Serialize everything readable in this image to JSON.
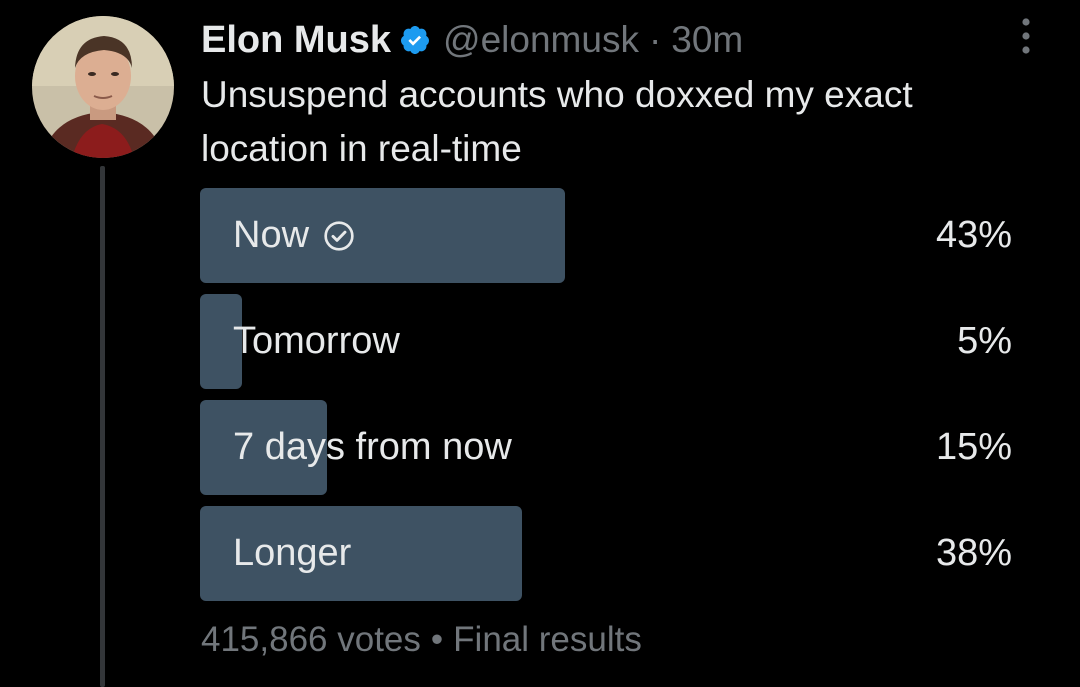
{
  "tweet": {
    "author_name": "Elon Musk",
    "handle": "@elonmusk",
    "separator": "·",
    "time": "30m",
    "text": "Unsuspend accounts who doxxed my exact location in real-time",
    "verified_icon": "verified-badge-icon",
    "more_icon": "more-options-icon",
    "accent_color": "#1d9bf0"
  },
  "poll": {
    "bar_color": "#3e5263",
    "options": [
      {
        "label": "Now",
        "percent_label": "43%",
        "percent": 43,
        "winner": true,
        "winner_icon": "check-circle-icon"
      },
      {
        "label": "Tomorrow",
        "percent_label": "5%",
        "percent": 5,
        "winner": false
      },
      {
        "label": "7 days from now",
        "percent_label": "15%",
        "percent": 15,
        "winner": false
      },
      {
        "label": "Longer",
        "percent_label": "38%",
        "percent": 38,
        "winner": false
      }
    ],
    "votes": "415,866 votes",
    "bullet": "•",
    "status": "Final results"
  }
}
